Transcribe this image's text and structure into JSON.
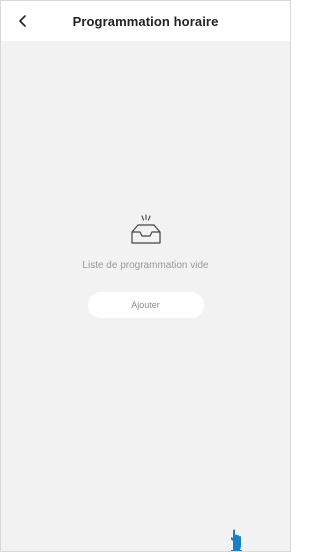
{
  "header": {
    "title": "Programmation horaire",
    "back_icon": "chevron-left-icon"
  },
  "empty_state": {
    "icon": "empty-inbox-icon",
    "message": "Liste de programmation vide",
    "add_label": "Ajouter"
  },
  "cursor": {
    "icon": "hand-pointer-icon",
    "color": "#1a7fc4"
  },
  "colors": {
    "background": "#f2f2f2",
    "header": "#ffffff",
    "title": "#222222",
    "muted_text": "#9a9a9a"
  }
}
